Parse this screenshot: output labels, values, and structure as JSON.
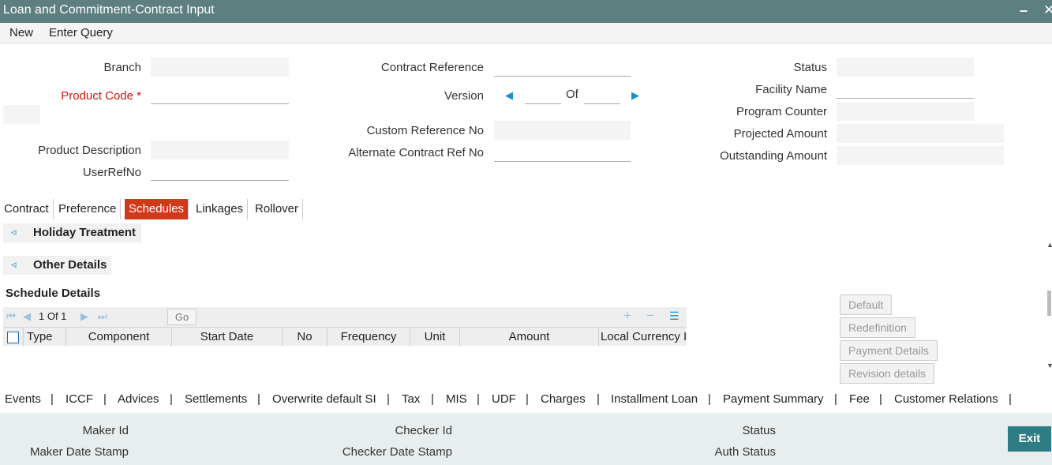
{
  "window": {
    "title": "Loan and Commitment-Contract Input",
    "minimize": "–",
    "close": "✕"
  },
  "menu": {
    "new": "New",
    "enter_query": "Enter Query"
  },
  "fields": {
    "branch": "Branch",
    "product_code": "Product Code",
    "required_mark": "*",
    "product_description": "Product Description",
    "user_ref_no": "UserRefNo",
    "contract_reference": "Contract Reference",
    "version": "Version",
    "of": "Of",
    "custom_reference_no": "Custom Reference No",
    "alternate_contract_ref_no": "Alternate Contract Ref No",
    "status": "Status",
    "facility_name": "Facility Name",
    "program_counter": "Program Counter",
    "projected_amount": "Projected Amount",
    "outstanding_amount": "Outstanding Amount"
  },
  "tabs": [
    "Contract",
    "Preference",
    "Schedules",
    "Linkages",
    "Rollover"
  ],
  "active_tab": "Schedules",
  "sections": {
    "holiday_treatment": "Holiday Treatment",
    "other_details": "Other Details",
    "schedule_details": "Schedule Details"
  },
  "grid": {
    "page_info": "1 Of 1",
    "go": "Go",
    "columns": [
      "Type",
      "Component",
      "Start Date",
      "No",
      "Frequency",
      "Unit",
      "Amount",
      "Local Currency I"
    ]
  },
  "side_buttons": [
    "Default",
    "Redefinition",
    "Payment Details",
    "Revision details"
  ],
  "subsystems": [
    "Events",
    "ICCF",
    "Advices",
    "Settlements",
    "Overwrite default SI",
    "Tax",
    "MIS",
    "UDF",
    "Charges",
    "Installment Loan",
    "Payment Summary",
    "Fee",
    "Customer Relations"
  ],
  "separator": "|",
  "footer": {
    "maker_id": "Maker Id",
    "maker_date_stamp": "Maker Date Stamp",
    "checker_id": "Checker Id",
    "checker_date_stamp": "Checker Date Stamp",
    "status": "Status",
    "auth_status": "Auth Status",
    "exit": "Exit"
  },
  "colors": {
    "titlebar": "#5e7f7f",
    "active_tab": "#d0391a",
    "exit_button": "#2f7d84",
    "required": "#d0140e",
    "nav_arrow": "#1a8fd0"
  }
}
